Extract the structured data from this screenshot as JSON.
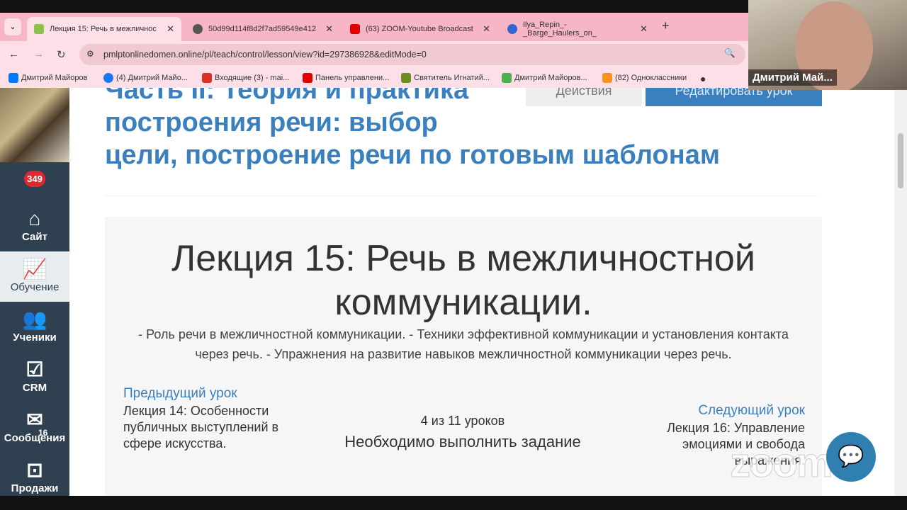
{
  "browser": {
    "tabs": [
      {
        "title": "Лекция 15: Речь в межличнос",
        "active": true,
        "favicon_color": "#8bc34a"
      },
      {
        "title": "50d99d114f8d2f7ad59549e412",
        "active": false,
        "favicon_color": "#555555"
      },
      {
        "title": "(63) ZOOM-Youtube Broadcast",
        "active": false,
        "favicon_color": "#e00000"
      },
      {
        "title": "Ilya_Repin_-_Barge_Haulers_on_",
        "active": false,
        "favicon_color": "#3366cc"
      }
    ],
    "new_tab": "+",
    "url": "pmlptonlinedomen.online/pl/teach/control/lesson/view?id=297386928&editMode=0",
    "bookmarks": [
      {
        "label": "Дмитрий Майоров",
        "color": "#0077ff"
      },
      {
        "label": "(4) Дмитрий Майо...",
        "color": "#1877f2"
      },
      {
        "label": "Входящие (3) - mai...",
        "color": "#d93025"
      },
      {
        "label": "Панель управлени...",
        "color": "#e00000"
      },
      {
        "label": "Святитель Игнатий...",
        "color": "#6b8e23"
      },
      {
        "label": "Дмитрий Майоров...",
        "color": "#4caf50"
      },
      {
        "label": "(82) Одноклассники",
        "color": "#f7931e"
      }
    ]
  },
  "video": {
    "participant": "Дмитрий Май..."
  },
  "sidebar": {
    "notifications": "349",
    "items": [
      {
        "label": "Сайт",
        "icon": "home-icon"
      },
      {
        "label": "Обучение",
        "icon": "chart-icon",
        "active": true
      },
      {
        "label": "Ученики",
        "icon": "users-icon"
      },
      {
        "label": "CRM",
        "icon": "checkbox-icon"
      },
      {
        "label": "Сообщения",
        "icon": "mail-icon",
        "badge": "16"
      },
      {
        "label": "Продажи",
        "icon": "safe-icon"
      }
    ]
  },
  "header": {
    "title_line1": "Часть II: Теория и практика",
    "title_line2": "построения речи: выбор",
    "title_line3": "цели, построение речи по готовым шаблонам",
    "actions_button": "Действия",
    "edit_button": "Редактировать урок"
  },
  "lesson": {
    "title": "Лекция 15: Речь в межличностной коммуникации.",
    "description": "- Роль речи в межличностной коммуникации. - Техники эффективной коммуникации и установления контакта через речь. - Упражнения на развитие навыков межличностной коммуникации через речь.",
    "prev_label": "Предыдущий урок",
    "prev_title": "Лекция 14: Особенности публичных выступлений в сфере искусства.",
    "progress": "4 из 11 уроков",
    "status": "Необходимо выполнить задание",
    "next_label": "Следующий урок",
    "next_title": "Лекция 16: Управление эмоциями и свобода выражения."
  },
  "watermark": "zoom"
}
